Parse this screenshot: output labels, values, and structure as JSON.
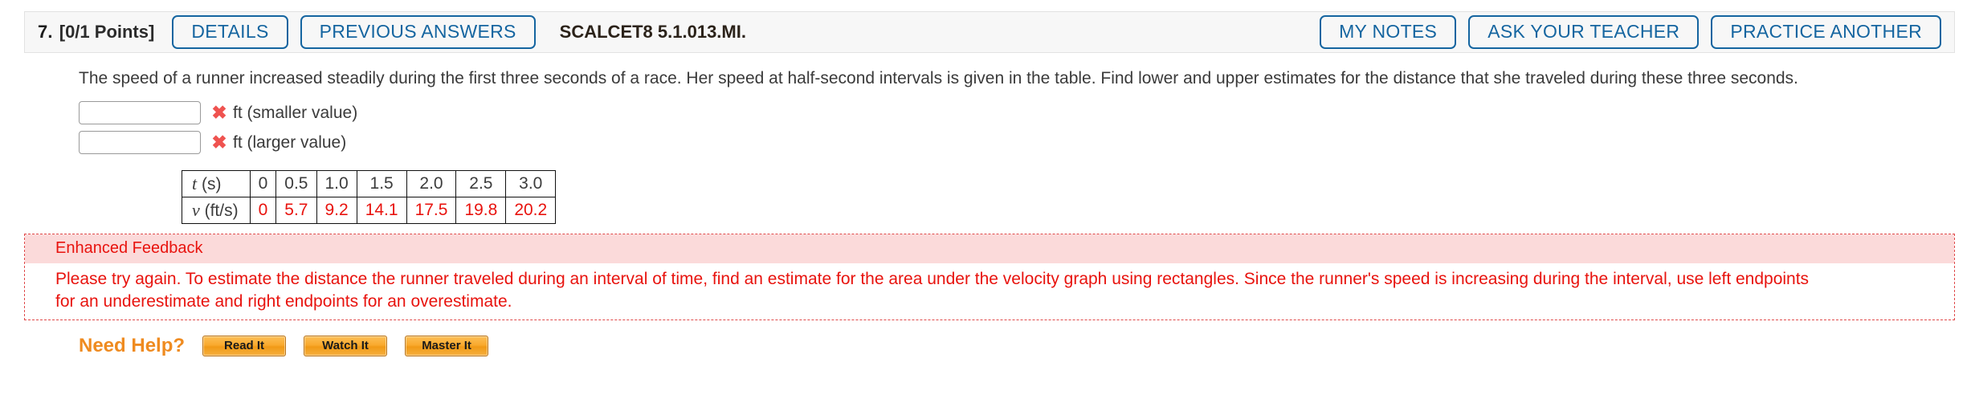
{
  "header": {
    "question_number": "7.",
    "points": "[0/1 Points]",
    "details_label": "DETAILS",
    "previous_answers_label": "PREVIOUS ANSWERS",
    "problem_code": "SCALCET8 5.1.013.MI.",
    "my_notes_label": "MY NOTES",
    "ask_teacher_label": "ASK YOUR TEACHER",
    "practice_another_label": "PRACTICE ANOTHER"
  },
  "problem": {
    "statement": "The speed of a runner increased steadily during the first three seconds of a race. Her speed at half-second intervals is given in the table. Find lower and upper estimates for the distance that she traveled during these three seconds."
  },
  "answers": [
    {
      "value": "",
      "placeholder": "",
      "status_icon": "incorrect-x-icon",
      "status_glyph": "✖",
      "label": "ft (smaller value)"
    },
    {
      "value": "",
      "placeholder": "",
      "status_icon": "incorrect-x-icon",
      "status_glyph": "✖",
      "label": "ft (larger value)"
    }
  ],
  "data_table": {
    "rows": [
      {
        "header_symbol": "t",
        "header_unit": "(s)",
        "values": [
          "0",
          "0.5",
          "1.0",
          "1.5",
          "2.0",
          "2.5",
          "3.0"
        ]
      },
      {
        "header_symbol": "v",
        "header_unit": "(ft/s)",
        "values": [
          "0",
          "5.7",
          "9.2",
          "14.1",
          "17.5",
          "19.8",
          "20.2"
        ]
      }
    ]
  },
  "chart_data": {
    "type": "table",
    "title": "Speed of a runner at half-second intervals",
    "xlabel": "t (s)",
    "ylabel": "v (ft/s)",
    "x": [
      0,
      0.5,
      1.0,
      1.5,
      2.0,
      2.5,
      3.0
    ],
    "values": [
      0,
      5.7,
      9.2,
      14.1,
      17.5,
      19.8,
      20.2
    ]
  },
  "feedback": {
    "title": "Enhanced Feedback",
    "line1": "Please try again. To estimate the distance the runner traveled during an interval of time, find an estimate for the area under the velocity graph using rectangles. Since the runner's speed is increasing during the interval, use left endpoints",
    "line2": "for an underestimate and right endpoints for an overestimate."
  },
  "need_help": {
    "label": "Need Help?",
    "buttons": [
      {
        "label": "Read It"
      },
      {
        "label": "Watch It"
      },
      {
        "label": "Master It"
      }
    ]
  },
  "colors": {
    "accent_blue": "#1565a0",
    "error_red": "#e8130e",
    "feedback_bg": "#fbdada",
    "help_orange": "#ef8b20"
  }
}
